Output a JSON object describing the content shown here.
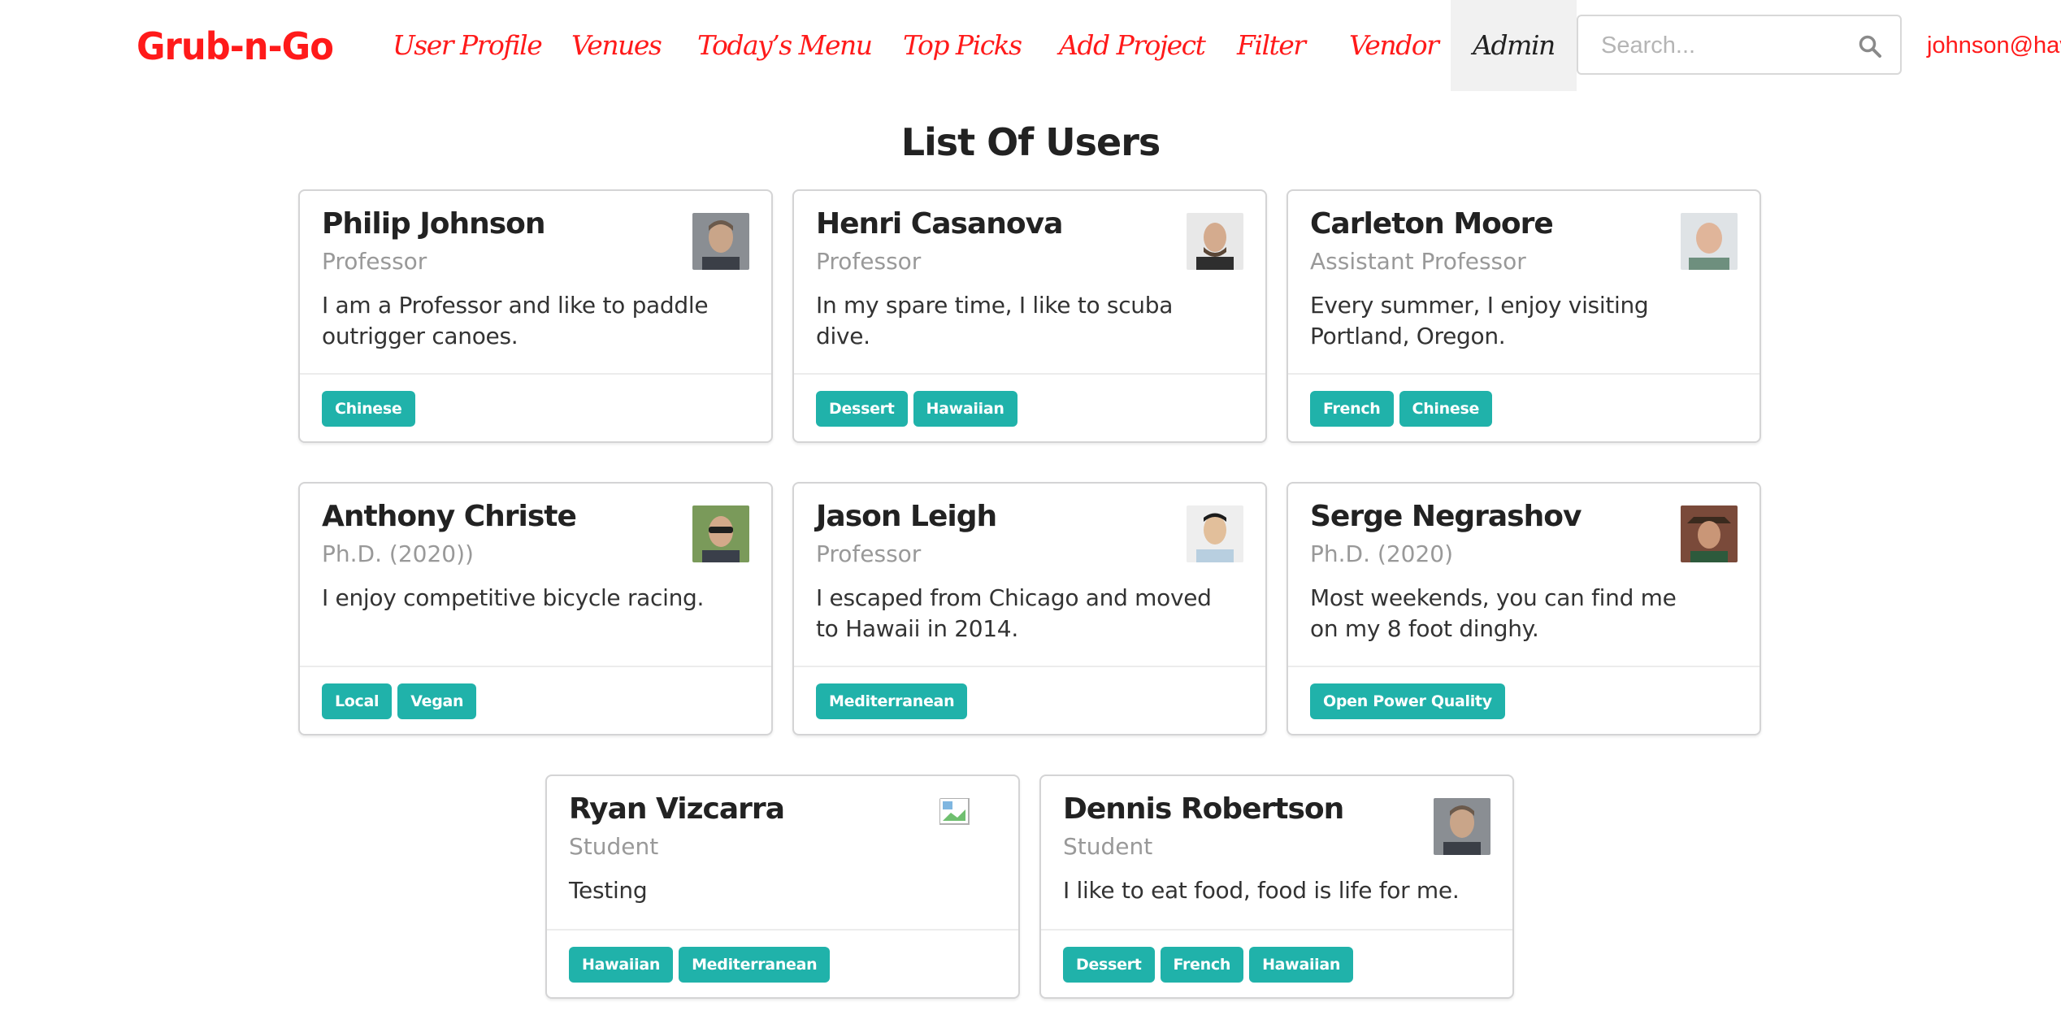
{
  "navbar": {
    "logo": "Grub-n-Go",
    "items": [
      "User Profile",
      "Venues",
      "Today’s Menu",
      "Top Picks",
      "Add Project",
      "Filter",
      "Vendor"
    ],
    "admin": "Admin",
    "search_placeholder": "Search...",
    "user_email": "johnson@hav"
  },
  "page": {
    "title": "List Of Users"
  },
  "users": [
    {
      "name": "Philip Johnson",
      "title": "Professor",
      "bio": "I am a Professor and like to paddle outrigger canoes.",
      "interests": [
        "Chinese"
      ]
    },
    {
      "name": "Henri Casanova",
      "title": "Professor",
      "bio": "In my spare time, I like to scuba dive.",
      "interests": [
        "Dessert",
        "Hawaiian"
      ]
    },
    {
      "name": "Carleton Moore",
      "title": "Assistant Professor",
      "bio": "Every summer, I enjoy visiting Portland, Oregon.",
      "interests": [
        "French",
        "Chinese"
      ]
    },
    {
      "name": "Anthony Christe",
      "title": "Ph.D. (2020))",
      "bio": "I enjoy competitive bicycle racing.",
      "interests": [
        "Local",
        "Vegan"
      ]
    },
    {
      "name": "Jason Leigh",
      "title": "Professor",
      "bio": "I escaped from Chicago and moved to Hawaii in 2014.",
      "interests": [
        "Mediterranean"
      ]
    },
    {
      "name": "Serge Negrashov",
      "title": "Ph.D. (2020)",
      "bio": "Most weekends, you can find me on my 8 foot dinghy.",
      "interests": [
        "Open Power Quality"
      ]
    },
    {
      "name": "Ryan Vizcarra",
      "title": "Student",
      "bio": "Testing",
      "interests": [
        "Hawaiian",
        "Mediterranean"
      ]
    },
    {
      "name": "Dennis Robertson",
      "title": "Student",
      "bio": "I like to eat food, food is life for me.",
      "interests": [
        "Dessert",
        "French",
        "Hawaiian"
      ]
    }
  ],
  "colors": {
    "brand": "#ff1a1a",
    "tag": "#20b2aa",
    "active_nav_bg": "#f1f1f1"
  },
  "icons": {
    "search": "search-icon",
    "avatar": "avatar"
  }
}
